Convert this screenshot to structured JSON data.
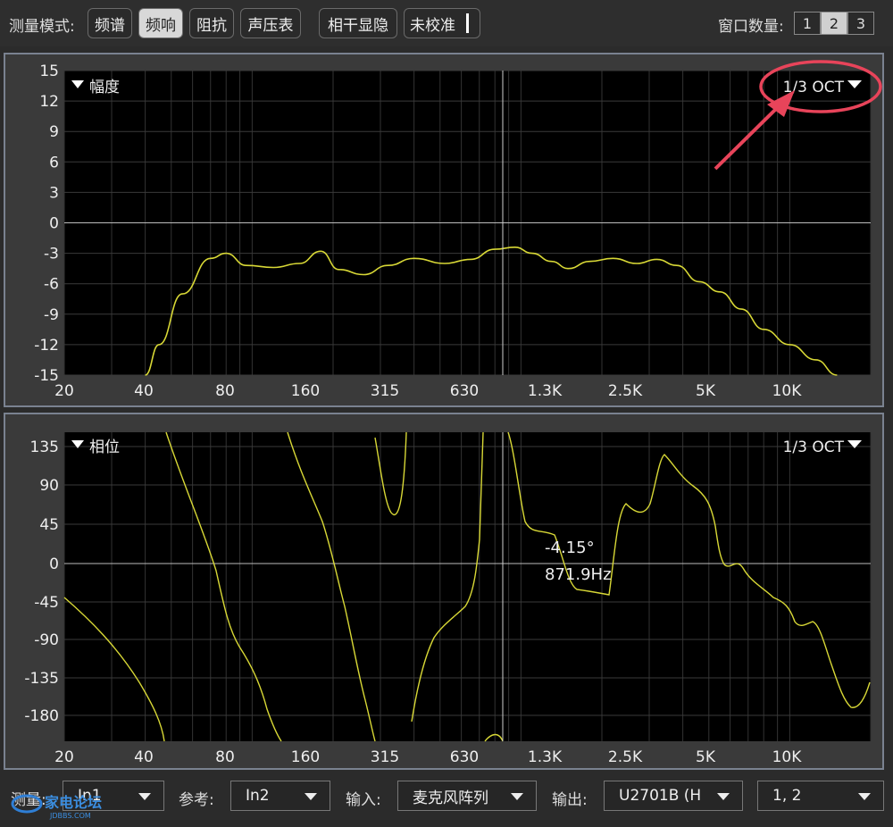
{
  "topbar": {
    "mode_label": "测量模式:",
    "modes": [
      "频谱",
      "频响",
      "阻抗",
      "声压表"
    ],
    "active_mode": 1,
    "coherence": "相干显隐",
    "calibration": "未校准",
    "window_label": "窗口数量:",
    "window_counts": [
      "1",
      "2",
      "3"
    ],
    "active_window": 1
  },
  "x_ticks": [
    "20",
    "40",
    "80",
    "160",
    "315",
    "630",
    "1.3K",
    "2.5K",
    "5K",
    "10K"
  ],
  "magnitude": {
    "title": "幅度",
    "smoothing": "1/3 OCT",
    "y_ticks": [
      "15",
      "12",
      "9",
      "6",
      "3",
      "0",
      "-3",
      "-6",
      "-9",
      "-12",
      "-15"
    ]
  },
  "phase": {
    "title": "相位",
    "smoothing": "1/3 OCT",
    "y_ticks": [
      "135",
      "90",
      "45",
      "0",
      "-45",
      "-90",
      "-135",
      "-180"
    ],
    "cursor_value": "-4.15°",
    "cursor_freq": "871.9Hz"
  },
  "bottombar": {
    "measure_label": "测量:",
    "measure_value": "In1",
    "ref_label": "参考:",
    "ref_value": "In2",
    "input_label": "输入:",
    "input_value": "麦克风阵列",
    "output_label": "输出:",
    "output_value": "U2701B (H",
    "channels_value": "1, 2",
    "watermark_text": "家电论坛",
    "watermark_sub": "JDBBS.COM"
  },
  "colors": {
    "trace": "#d8d836",
    "grid": "#3a3a3a",
    "plot_bg": "#000000",
    "annotation": "#e8445a"
  },
  "chart_data": [
    {
      "type": "line",
      "title": "幅度",
      "x_scale": "log",
      "xlim": [
        20,
        20000
      ],
      "ylim": [
        -15,
        15
      ],
      "x": [
        40,
        45,
        55,
        70,
        80,
        95,
        120,
        150,
        180,
        210,
        260,
        320,
        400,
        520,
        650,
        800,
        950,
        1100,
        1300,
        1500,
        1800,
        2200,
        2700,
        3200,
        3800,
        4600,
        5500,
        6600,
        8000,
        10000,
        12500,
        15000
      ],
      "y": [
        -17,
        -12,
        -7,
        -3.5,
        -3,
        -4.2,
        -4.4,
        -4,
        -2.8,
        -4.6,
        -5.1,
        -4.2,
        -3.5,
        -4,
        -3.6,
        -2.6,
        -2.4,
        -3,
        -3.8,
        -4.5,
        -3.8,
        -3.5,
        -4,
        -3.6,
        -4.2,
        -5.8,
        -6.8,
        -8.5,
        -10.5,
        -12,
        -13.5,
        -15
      ]
    },
    {
      "type": "line",
      "title": "相位",
      "x_scale": "log",
      "xlim": [
        20,
        20000
      ],
      "ylim": [
        -200,
        145
      ],
      "x": [
        960,
        1050,
        1150,
        1300,
        1450,
        1600,
        1800,
        2000,
        2100,
        2200,
        2350,
        2500,
        2800,
        3000,
        3200,
        3500,
        4000,
        4600,
        5000,
        5500,
        6000,
        6600,
        7500,
        9000,
        10500,
        11500,
        13000,
        14000,
        15500,
        17000,
        19000
      ],
      "y": [
        140,
        60,
        40,
        35,
        20,
        5,
        -15,
        -20,
        -25,
        -30,
        70,
        60,
        75,
        90,
        125,
        110,
        90,
        70,
        30,
        0,
        -5,
        -10,
        -25,
        -40,
        -55,
        -65,
        -70,
        -100,
        -140,
        -160,
        -130
      ]
    }
  ]
}
